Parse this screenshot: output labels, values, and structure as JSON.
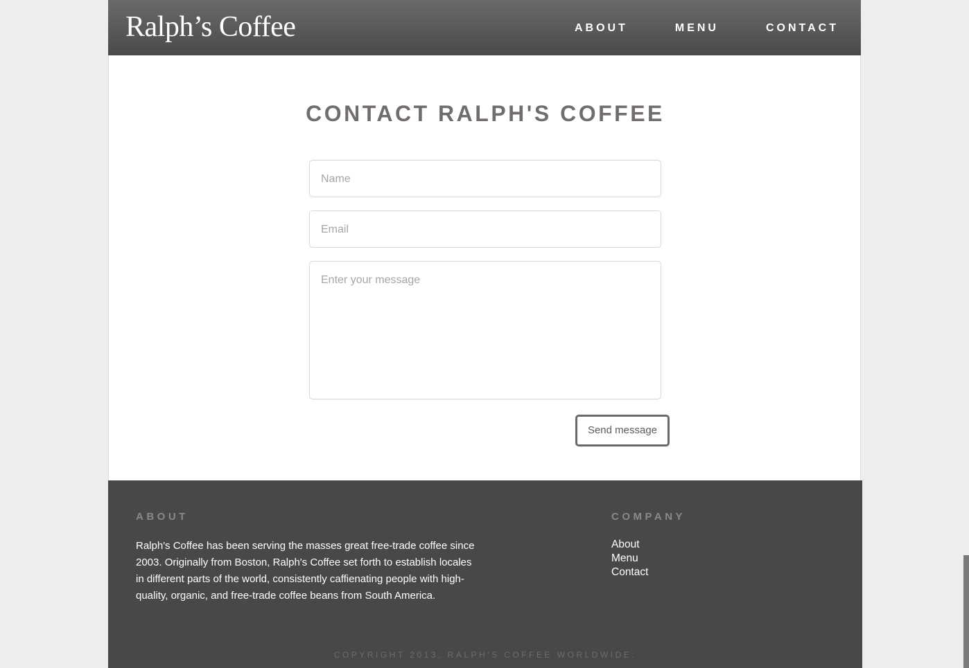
{
  "header": {
    "logo_text": "Ralph’s Coffee",
    "nav": {
      "about": "ABOUT",
      "menu": "MENU",
      "contact": "CONTACT"
    }
  },
  "main": {
    "title": "CONTACT RALPH'S COFFEE",
    "form": {
      "name_placeholder": "Name",
      "email_placeholder": "Email",
      "message_placeholder": "Enter your message",
      "submit_label": "Send message"
    }
  },
  "footer": {
    "about_heading": "ABOUT",
    "about_text": "Ralph's Coffee has been serving the masses great free-trade coffee since 2003. Originally from Boston, Ralph's Coffee set forth to establish locales in different parts of the world, consistently caffienating people with high-quality, organic, and free-trade coffee beans from South America.",
    "company_heading": "COMPANY",
    "company_links": {
      "about": "About",
      "menu": "Menu",
      "contact": "Contact"
    },
    "copyright": "COPYRIGHT 2013, RALPH'S COFFEE WORLDWIDE."
  },
  "colors": {
    "header_bg": "#5a5a5a",
    "footer_bg": "#484848",
    "title_color": "#726d6d",
    "page_bg": "#ededed"
  }
}
